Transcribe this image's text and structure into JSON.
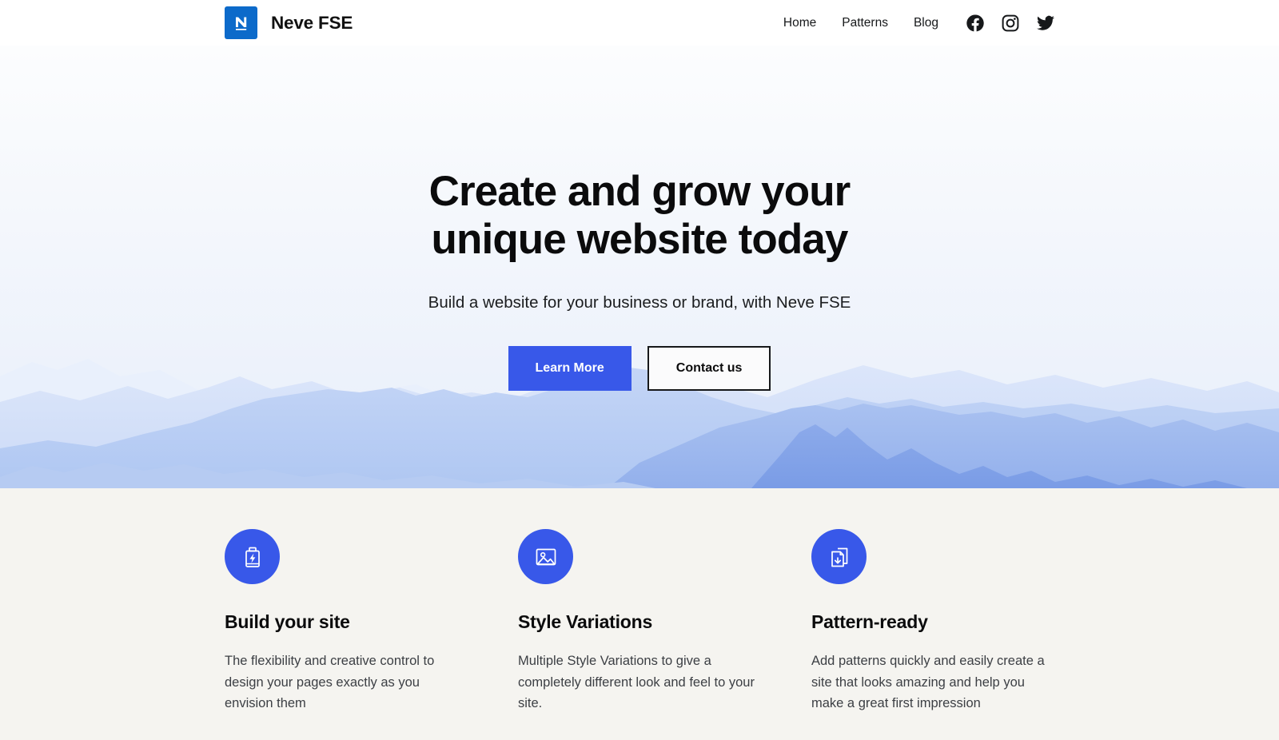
{
  "header": {
    "brand": {
      "name": "Neve FSE",
      "logo_icon": "neve-n-logo-icon",
      "logo_bg": "#0C6ACA"
    },
    "nav": [
      {
        "label": "Home",
        "name": "nav-link-home"
      },
      {
        "label": "Patterns",
        "name": "nav-link-patterns"
      },
      {
        "label": "Blog",
        "name": "nav-link-blog"
      }
    ],
    "social": [
      {
        "icon": "facebook-icon",
        "label": "Facebook"
      },
      {
        "icon": "instagram-icon",
        "label": "Instagram"
      },
      {
        "icon": "twitter-icon",
        "label": "Twitter"
      }
    ]
  },
  "hero": {
    "title_line1": "Create and grow your",
    "title_line2": "unique website today",
    "subtitle": "Build a website for your business or brand, with Neve FSE",
    "primary_button": "Learn More",
    "secondary_button": "Contact us",
    "background_image": "mountain-range-silhouette",
    "accent_color": "#3858E9"
  },
  "features": {
    "background_color": "#F5F4F0",
    "items": [
      {
        "icon": "battery-bolt-icon",
        "title": "Build your site",
        "text": "The flexibility and creative control to design your pages exactly as you envision them"
      },
      {
        "icon": "image-icon",
        "title": "Style Variations",
        "text": "Multiple Style Variations to give a completely different look and feel to your site."
      },
      {
        "icon": "documents-download-icon",
        "title": "Pattern-ready",
        "text": "Add patterns quickly and easily create a site that looks amazing and help you make a great first impression"
      }
    ]
  }
}
